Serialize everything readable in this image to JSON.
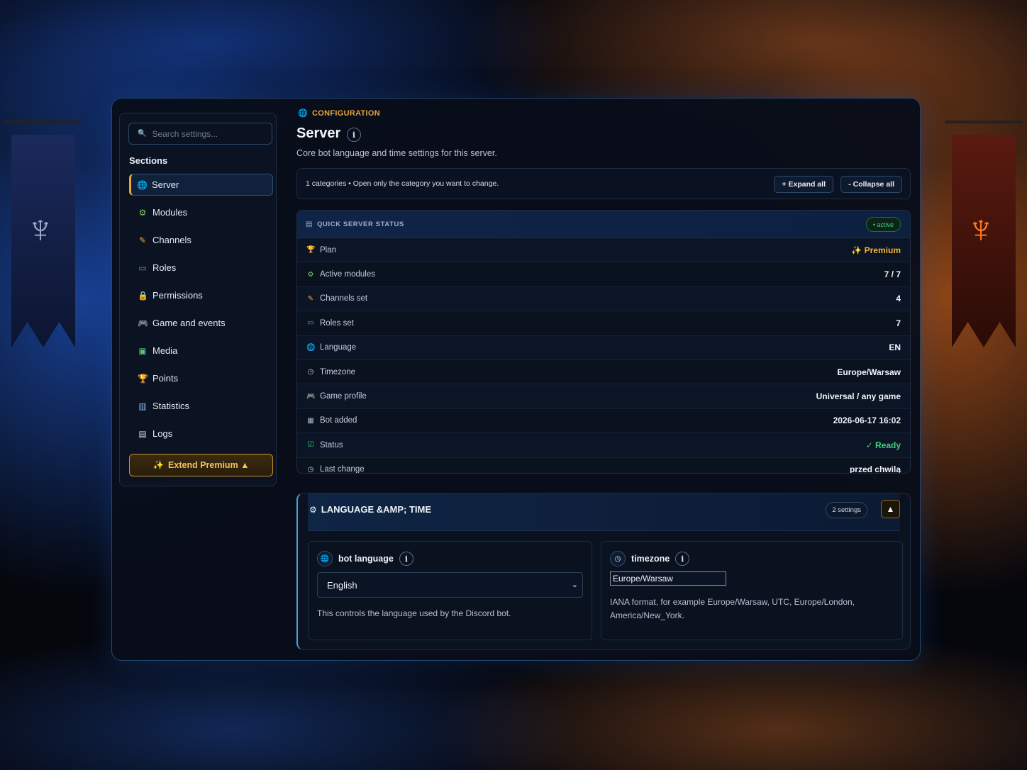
{
  "sidebar": {
    "search_placeholder": "Search settings...",
    "sections_title": "Sections",
    "items": [
      {
        "label": "Server",
        "icon": "globe-icon",
        "glyph": "🌐",
        "active": true
      },
      {
        "label": "Modules",
        "icon": "gear-icon",
        "glyph": "⚙",
        "active": false
      },
      {
        "label": "Channels",
        "icon": "pencil-icon",
        "glyph": "✎",
        "active": false
      },
      {
        "label": "Roles",
        "icon": "id-card-icon",
        "glyph": "▭",
        "active": false
      },
      {
        "label": "Permissions",
        "icon": "lock-icon",
        "glyph": "🔒",
        "active": false
      },
      {
        "label": "Game and events",
        "icon": "gamepad-icon",
        "glyph": "🎮",
        "active": false
      },
      {
        "label": "Media",
        "icon": "image-icon",
        "glyph": "▣",
        "active": false
      },
      {
        "label": "Points",
        "icon": "trophy-icon",
        "glyph": "🏆",
        "active": false
      },
      {
        "label": "Statistics",
        "icon": "chart-icon",
        "glyph": "▥",
        "active": false
      },
      {
        "label": "Logs",
        "icon": "scroll-icon",
        "glyph": "▤",
        "active": false
      }
    ],
    "premium_button": "Extend Premium ▲"
  },
  "header": {
    "eyebrow": "CONFIGURATION",
    "title": "Server",
    "subtitle": "Core bot language and time settings for this server."
  },
  "toolbar": {
    "hint": "1 categories • Open only the category you want to change.",
    "expand_all": "+ Expand all",
    "collapse_all": "- Collapse all"
  },
  "status": {
    "title": "QUICK SERVER STATUS",
    "badge": "• active",
    "rows": [
      {
        "label": "Plan",
        "icon": "trophy-icon",
        "glyph": "🏆",
        "value": "✨ Premium",
        "tone": "gold"
      },
      {
        "label": "Active modules",
        "icon": "gear-icon",
        "glyph": "⚙",
        "value": "7 / 7",
        "tone": ""
      },
      {
        "label": "Channels set",
        "icon": "pencil-icon",
        "glyph": "✎",
        "value": "4",
        "tone": ""
      },
      {
        "label": "Roles set",
        "icon": "id-card-icon",
        "glyph": "▭",
        "value": "7",
        "tone": ""
      },
      {
        "label": "Language",
        "icon": "globe-icon",
        "glyph": "🌐",
        "value": "EN",
        "tone": ""
      },
      {
        "label": "Timezone",
        "icon": "clock-icon",
        "glyph": "◷",
        "value": "Europe/Warsaw",
        "tone": ""
      },
      {
        "label": "Game profile",
        "icon": "gamepad-icon",
        "glyph": "🎮",
        "value": "Universal / any game",
        "tone": ""
      },
      {
        "label": "Bot added",
        "icon": "calendar-icon",
        "glyph": "▦",
        "value": "2026-06-17 16:02",
        "tone": ""
      },
      {
        "label": "Status",
        "icon": "checkbox-icon",
        "glyph": "☑",
        "value": "✓ Ready",
        "tone": "green"
      },
      {
        "label": "Last change",
        "icon": "clock-icon",
        "glyph": "◷",
        "value": "przed chwilą",
        "tone": ""
      }
    ]
  },
  "language_time": {
    "title": "LANGUAGE &AMP; TIME",
    "count": "2 settings",
    "bot_language": {
      "label": "bot language",
      "value": "English",
      "description": "This controls the language used by the Discord bot."
    },
    "timezone": {
      "label": "timezone",
      "value": "Europe/Warsaw",
      "description": "IANA format, for example Europe/Warsaw, UTC, Europe/London, America/New_York."
    }
  },
  "colors": {
    "accent_gold": "#e6a43a",
    "accent_blue": "#4fa0d8",
    "success": "#3fd07a"
  }
}
